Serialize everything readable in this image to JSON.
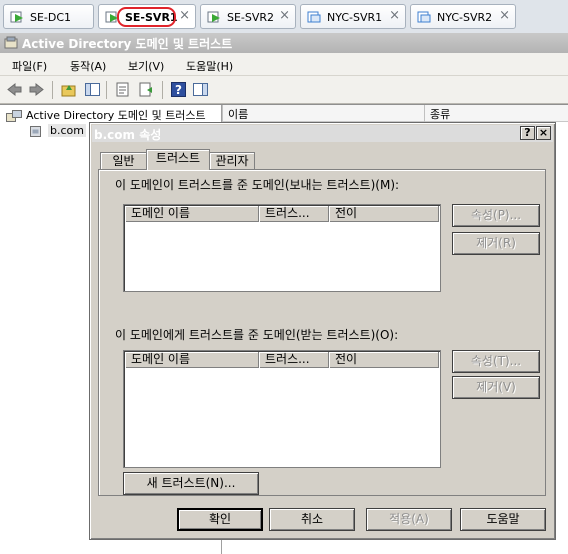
{
  "session_tabs": [
    {
      "label": "SE-DC1",
      "active": false
    },
    {
      "label": "SE-SVR1",
      "active": true
    },
    {
      "label": "SE-SVR2",
      "active": false
    },
    {
      "label": "NYC-SVR1",
      "active": false
    },
    {
      "label": "NYC-SVR2",
      "active": false
    }
  ],
  "close_glyph": "×",
  "mmc": {
    "title": "Active Directory 도메인 및 트러스트",
    "menu": [
      "파일(F)",
      "동작(A)",
      "보기(V)",
      "도움말(H)"
    ],
    "tree": {
      "root": "Active Directory 도메인 및 트러스트",
      "child": "b.com"
    },
    "list_columns": [
      "이름",
      "종류"
    ]
  },
  "dialog": {
    "title": "b.com 속성",
    "help_glyph": "?",
    "close_glyph": "×",
    "tabs": [
      "일반",
      "트러스트",
      "관리자"
    ],
    "active_tab": "트러스트",
    "outgoing": {
      "label": "이 도메인이 트러스트를 준 도메인(보내는 트러스트)(M):",
      "columns": [
        "도메인 이름",
        "트러스...",
        "전이"
      ],
      "rows": [],
      "properties_button": "속성(P)...",
      "remove_button": "제거(R)"
    },
    "incoming": {
      "label": "이 도메인에게 트러스트를 준 도메인(받는 트러스트)(O):",
      "columns": [
        "도메인 이름",
        "트러스...",
        "전이"
      ],
      "rows": [],
      "properties_button": "속성(T)...",
      "remove_button": "제거(V)"
    },
    "new_trust_button": "새 트러스트(N)...",
    "footer": {
      "ok": "확인",
      "cancel": "취소",
      "apply": "적용(A)",
      "help": "도움말"
    }
  },
  "colors": {
    "dialog_face": "#d4d0c8",
    "highlight_ring": "#e0242b",
    "vm_icon_green": "#3aa935",
    "vm_icon_blue": "#3d7fd0"
  }
}
